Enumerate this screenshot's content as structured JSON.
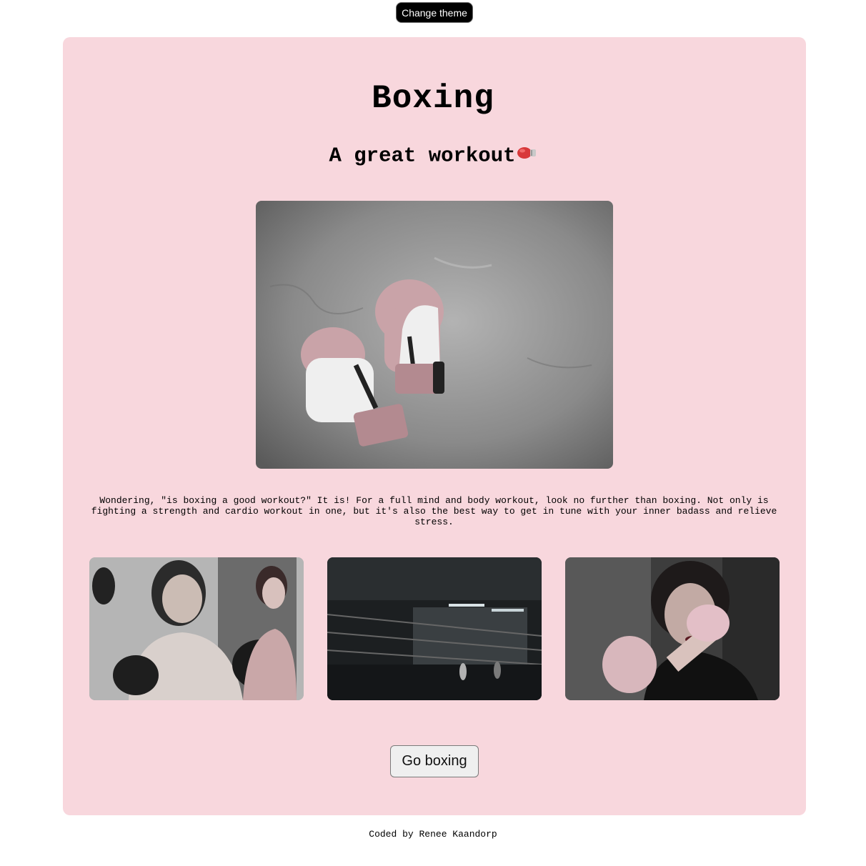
{
  "theme_button": {
    "label": "Change theme"
  },
  "card": {
    "title": "Boxing",
    "subtitle": "A great workout",
    "subtitle_icon": "boxing-glove-emoji",
    "description": "Wondering, \"is boxing a good workout?\" It is! For a full mind and body workout, look no further than boxing. Not only is fighting a strength and cardio workout in one, but it's also the best way to get in tune with your inner badass and relieve stress.",
    "cta_label": "Go boxing"
  },
  "footer": {
    "text": "Coded by Renee Kaandorp"
  },
  "colors": {
    "card_bg": "#f8d7dd",
    "theme_button_bg": "#000000",
    "cta_bg": "#efefef"
  }
}
